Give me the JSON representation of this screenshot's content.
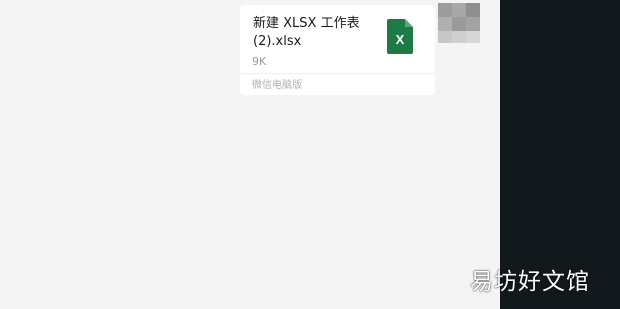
{
  "message": {
    "file_name": "新建 XLSX 工作表(2).xlsx",
    "file_size": "9K",
    "source_label": "微信电脑版",
    "file_icon": "excel-file-icon",
    "file_icon_letter": "X",
    "file_icon_color": "#1f7a45"
  },
  "watermark": {
    "text": "易坊好文馆"
  },
  "colors": {
    "chat_background": "#f4f4f4",
    "right_panel": "#12191c",
    "card_background": "#ffffff"
  }
}
